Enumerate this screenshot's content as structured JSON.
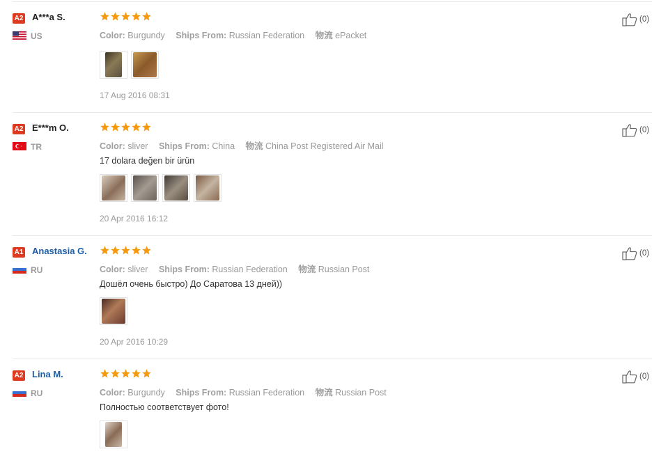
{
  "reviews": [
    {
      "level": "A2",
      "name": "A***a S.",
      "country": "US",
      "flag": "us",
      "rating": 5,
      "color_label": "Color:",
      "color": "Burgundy",
      "ships_label": "Ships From:",
      "ships": "Russian Federation",
      "logistics_label": "物流",
      "logistics": "ePacket",
      "comment": "",
      "images": [
        {
          "tone": "#6b5a3a"
        },
        {
          "tone": "#a67a3e"
        }
      ],
      "date": "17 Aug 2016 08:31",
      "helpful": "(0)"
    },
    {
      "level": "A2",
      "name": "E***m O.",
      "country": "TR",
      "flag": "tr",
      "rating": 5,
      "color_label": "Color:",
      "color": "sliver",
      "ships_label": "Ships From:",
      "ships": "China",
      "logistics_label": "物流",
      "logistics": "China Post Registered Air Mail",
      "comment": "17 dolara değen bir ürün",
      "images": [
        {
          "tone": "#8c7b6e"
        },
        {
          "tone": "#6f6a64"
        },
        {
          "tone": "#7a6a5c"
        },
        {
          "tone": "#9a8670"
        }
      ],
      "date": "20 Apr 2016 16:12",
      "helpful": "(0)"
    },
    {
      "level": "A1",
      "name": "Anastasia G.",
      "country": "RU",
      "flag": "ru",
      "rating": 5,
      "color_label": "Color:",
      "color": "sliver",
      "ships_label": "Ships From:",
      "ships": "Russian Federation",
      "logistics_label": "物流",
      "logistics": "Russian Post",
      "comment": "Дошёл очень быстро) До Саратова 13 дней))",
      "images": [
        {
          "tone": "#7a4a3a"
        }
      ],
      "date": "20 Apr 2016 10:29",
      "helpful": "(0)"
    },
    {
      "level": "A2",
      "name": "Lina M.",
      "country": "RU",
      "flag": "ru",
      "rating": 5,
      "color_label": "Color:",
      "color": "Burgundy",
      "ships_label": "Ships From:",
      "ships": "Russian Federation",
      "logistics_label": "物流",
      "logistics": "Russian Post",
      "comment": "Полностью соответствует фото!",
      "images": [
        {
          "tone": "#8a6a55"
        }
      ],
      "date": "",
      "helpful": "(0)"
    }
  ],
  "colors": {
    "badge": "#dd3a1f",
    "star": "#f59a0f",
    "link": "#1b5ea8"
  }
}
